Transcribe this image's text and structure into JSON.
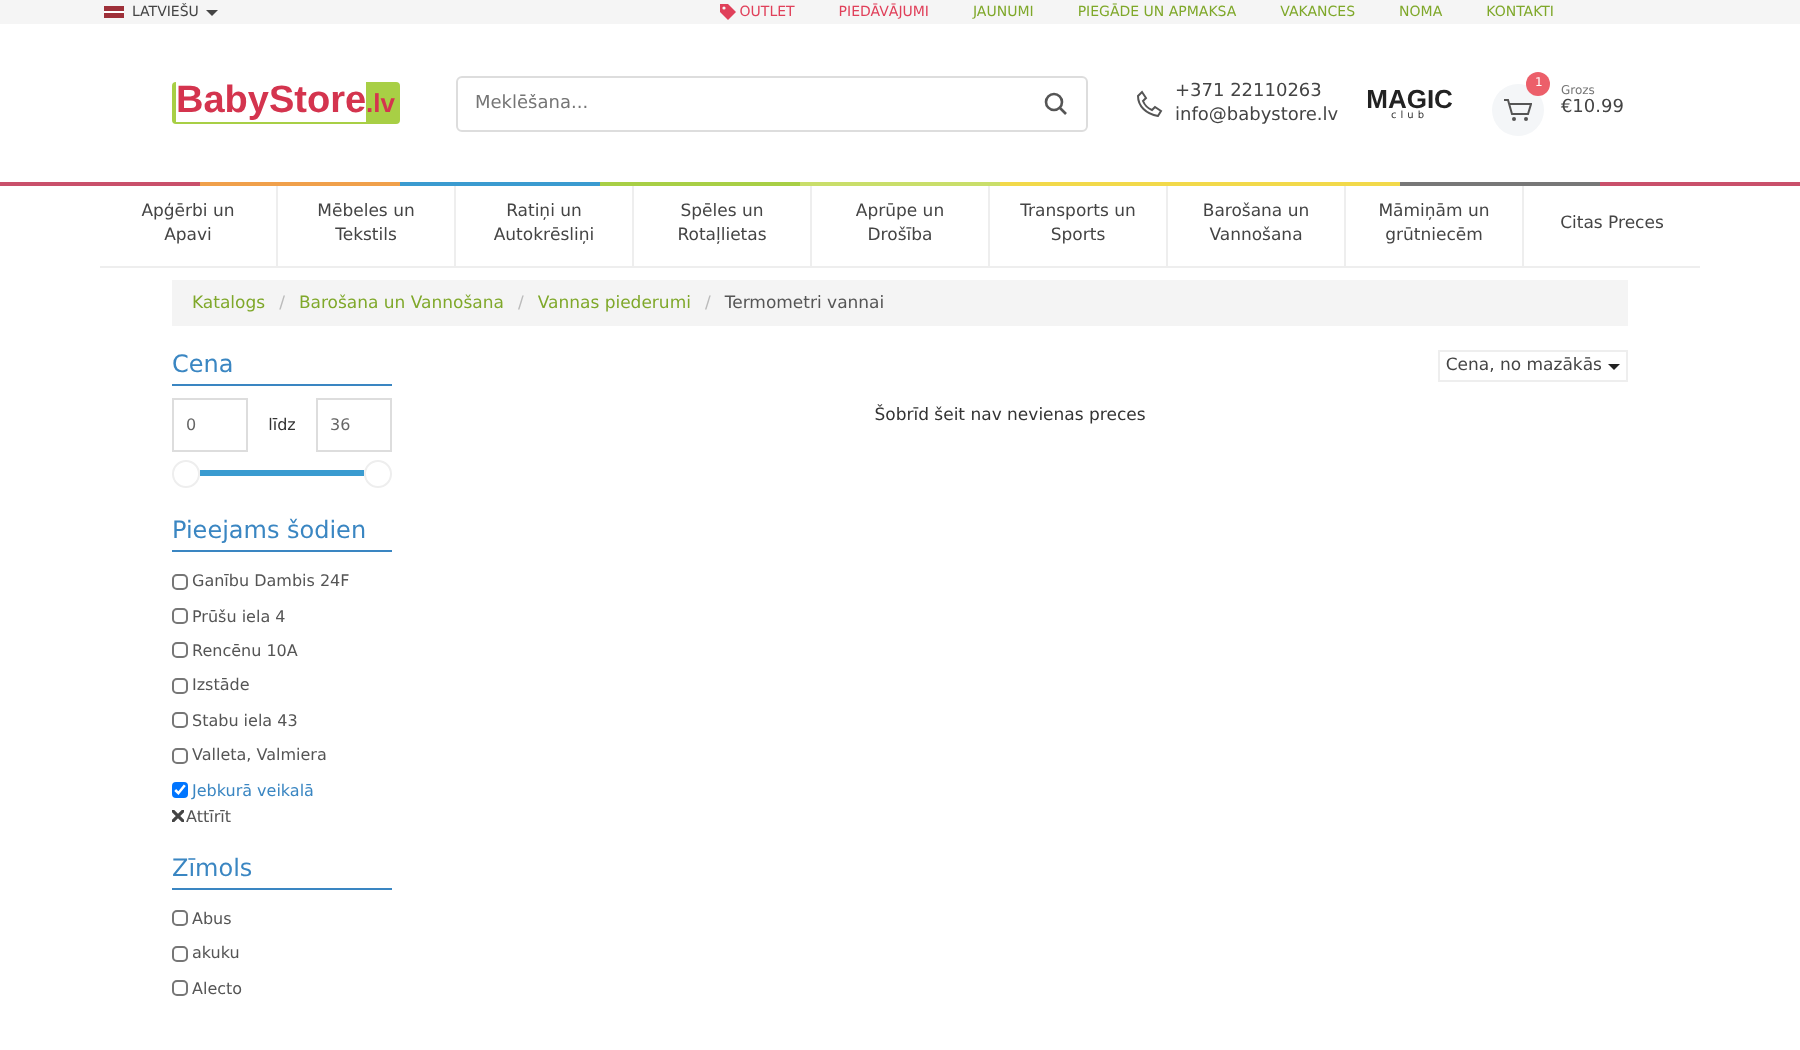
{
  "topbar": {
    "language": "LATVIEŠU",
    "links": [
      {
        "label": "OUTLET",
        "kind": "sale"
      },
      {
        "label": "PIEDĀVĀJUMI",
        "kind": "sale"
      },
      {
        "label": "JAUNUMI",
        "kind": "normal"
      },
      {
        "label": "PIEGĀDE UN APMAKSA",
        "kind": "normal"
      },
      {
        "label": "VAKANCES",
        "kind": "normal"
      },
      {
        "label": "NOMA",
        "kind": "normal"
      },
      {
        "label": "KONTAKTI",
        "kind": "normal"
      }
    ]
  },
  "header": {
    "logo_main": "BabyStore",
    "logo_suffix": ".lv",
    "search": {
      "placeholder": "Meklēšana..."
    },
    "phone": "+371 22110263",
    "email": "info@babystore.lv",
    "club_logo": "MAGIC",
    "club_sub": "club",
    "cart": {
      "count": "1",
      "label": "Grozs",
      "total": "€10.99"
    }
  },
  "nav": [
    {
      "label": "Apģērbi un Apavi",
      "color": "#c9506b"
    },
    {
      "label": "Mēbeles un Tekstils",
      "color": "#f0a04b"
    },
    {
      "label": "Ratiņi un Autokrēsliņi",
      "color": "#3a9bd0"
    },
    {
      "label": "Spēles un Rotaļlietas",
      "color": "#a8cf45"
    },
    {
      "label": "Aprūpe un Drošība",
      "color": "#c9de6a"
    },
    {
      "label": "Transports un Sports",
      "color": "#f2d94a"
    },
    {
      "label": "Barošana un Vannošana",
      "color": "#f2d94a"
    },
    {
      "label": "Māmiņām un grūtniecēm",
      "color": "#777777"
    },
    {
      "label": "Citas Preces",
      "color": "#c9506b"
    }
  ],
  "breadcrumb_separator": "/",
  "breadcrumb": [
    {
      "label": "Katalogs",
      "kind": "link"
    },
    {
      "label": "Barošana un Vannošana",
      "kind": "link"
    },
    {
      "label": "Vannas piederumi",
      "kind": "link"
    },
    {
      "label": "Termometri vannai",
      "kind": "current"
    }
  ],
  "sidebar": {
    "price": {
      "title": "Cena",
      "min": "0",
      "to_label": "līdz",
      "max": "36",
      "level": 1
    },
    "availability": {
      "title": "Pieejams šodien",
      "items": [
        {
          "label": "Ganību Dambis 24F",
          "checked": false
        },
        {
          "label": "Prūšu iela 4",
          "checked": false
        },
        {
          "label": "Rencēnu 10A",
          "checked": false
        },
        {
          "label": "Izstāde",
          "checked": false
        },
        {
          "label": "Stabu iela 43",
          "checked": false
        },
        {
          "label": "Valleta, Valmiera",
          "checked": false
        },
        {
          "label": "Jebkurā veikalā",
          "checked": true
        }
      ],
      "clear": "Attīrīt"
    },
    "brand": {
      "title": "Zīmols",
      "items": [
        {
          "label": "Abus",
          "checked": false
        },
        {
          "label": "akuku",
          "checked": false
        },
        {
          "label": "Alecto",
          "checked": false
        }
      ]
    }
  },
  "content": {
    "sort": "Cena, no mazākās",
    "empty_message": "Šobrīd šeit nav nevienas preces"
  }
}
